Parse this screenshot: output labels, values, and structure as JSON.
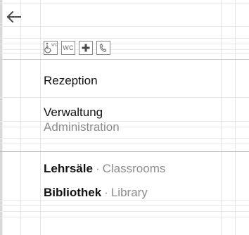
{
  "accessibility_icons": [
    {
      "icon": "wheelchair-wc-icon",
      "label": "WC"
    },
    {
      "icon": "wc-icon",
      "label": "WC"
    },
    {
      "icon": "first-aid-icon"
    },
    {
      "icon": "phone-icon"
    }
  ],
  "entries": {
    "reception": {
      "name": "Rezeption"
    },
    "administration": {
      "name": "Verwaltung",
      "translation": "Administration"
    },
    "classrooms": {
      "name": "Lehrsäle",
      "separator": "·",
      "translation": "Classrooms"
    },
    "library": {
      "name": "Bibliothek",
      "separator": "·",
      "translation": "Library"
    }
  },
  "colors": {
    "text": "#111111",
    "secondary_text": "#8c8c8c",
    "icon_stroke": "#6d6d6d",
    "grid": "#e6e6e6"
  }
}
